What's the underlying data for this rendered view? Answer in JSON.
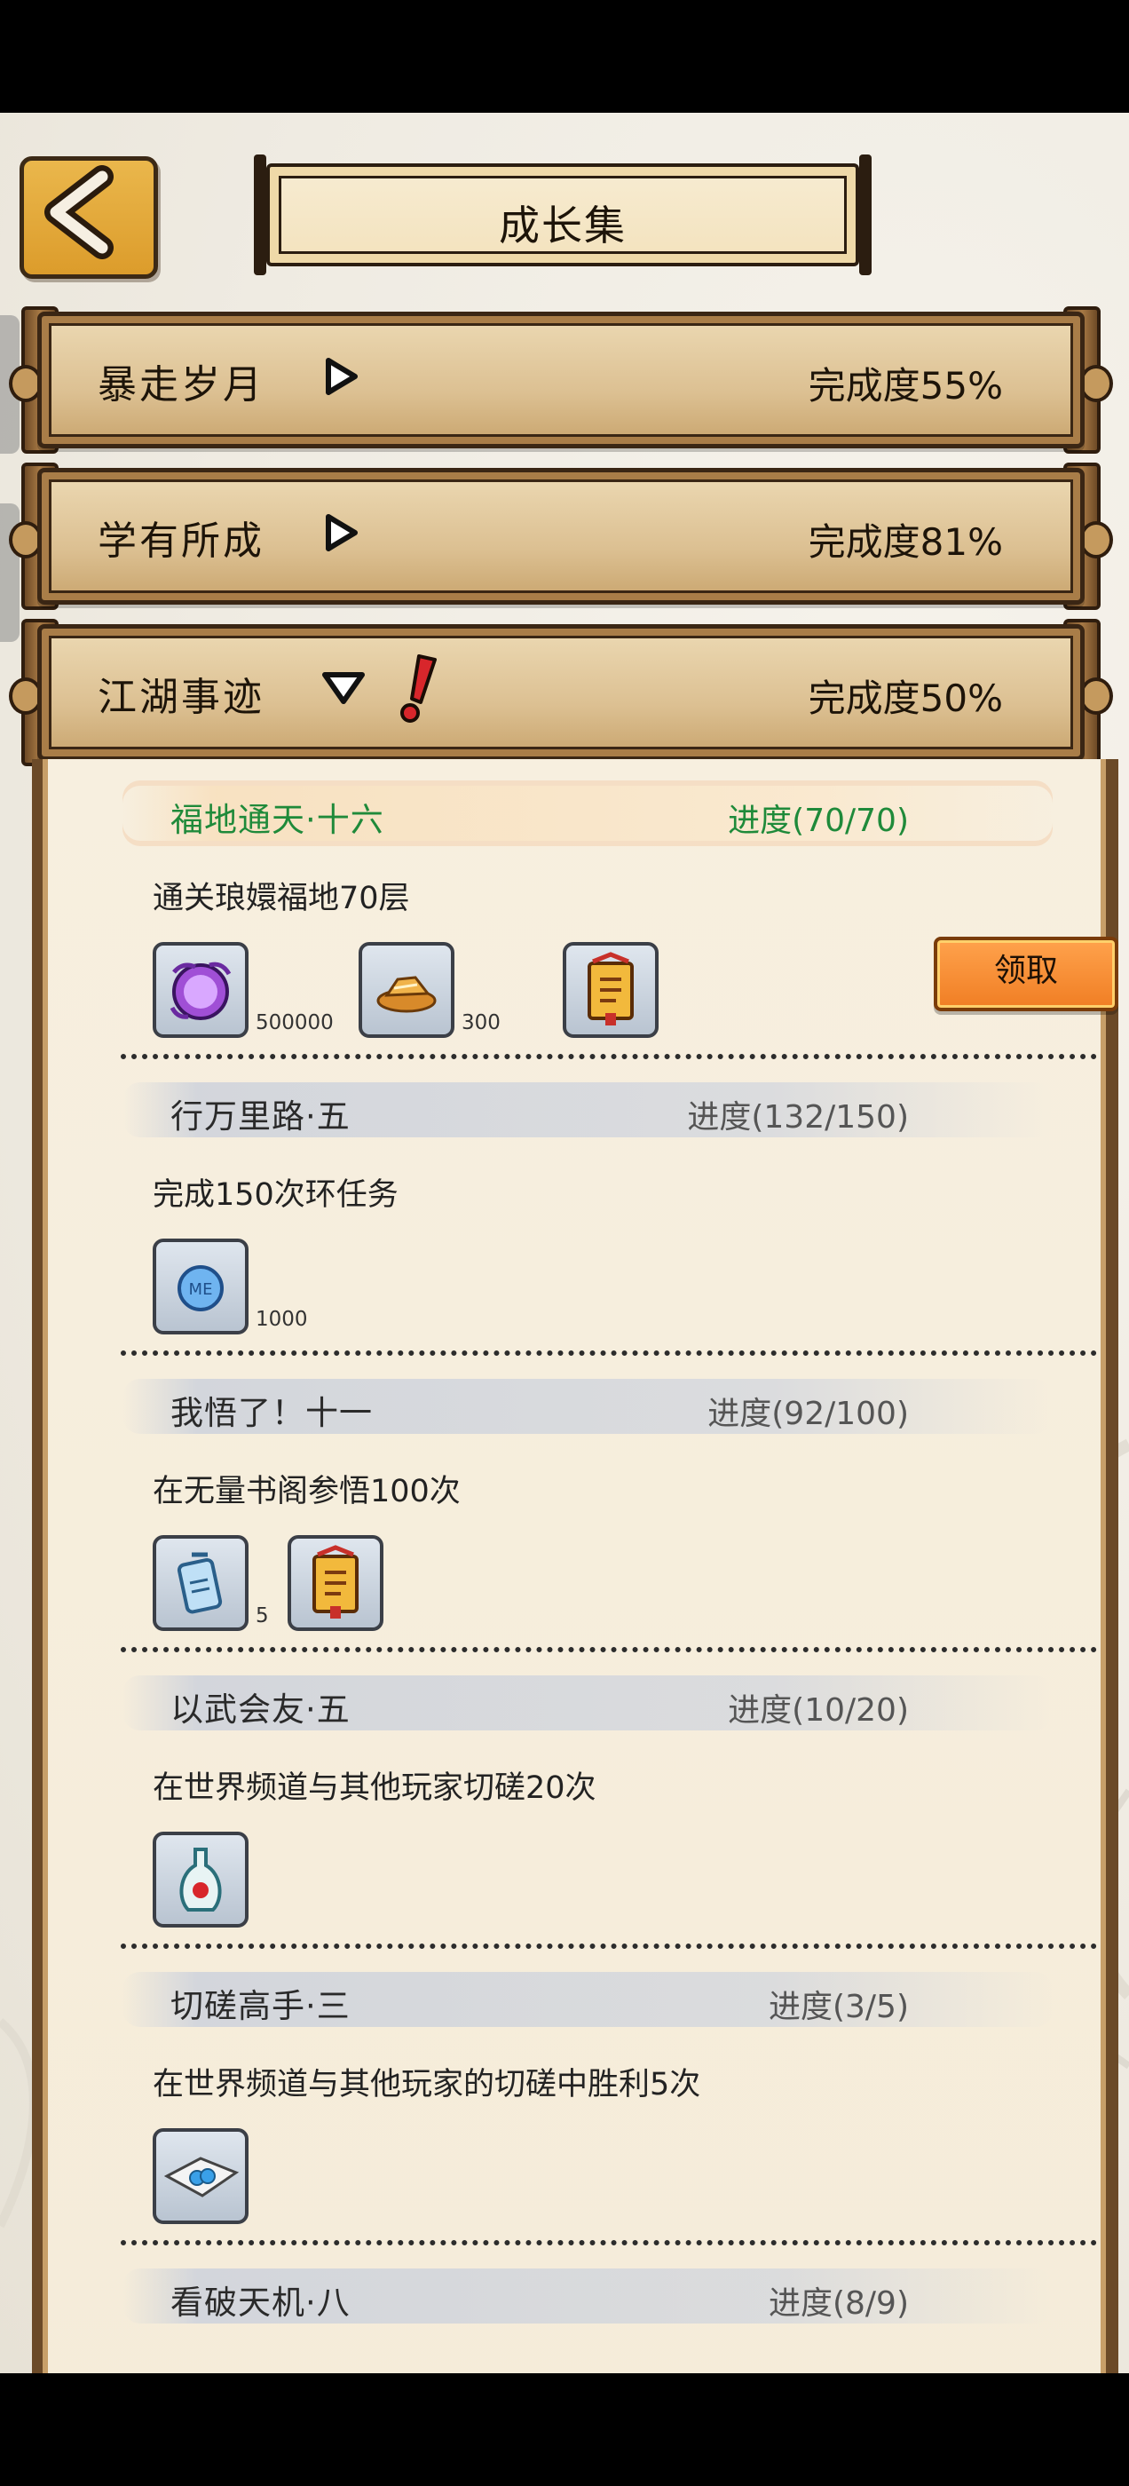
{
  "header": {
    "title": "成长集",
    "back_icon": "chevron-left-icon"
  },
  "categories": [
    {
      "name": "暴走岁月",
      "progress": "完成度55%",
      "state": "collapsed"
    },
    {
      "name": "学有所成",
      "progress": "完成度81%",
      "state": "collapsed"
    },
    {
      "name": "江湖事迹",
      "progress": "完成度50%",
      "state": "expanded",
      "alert": true
    }
  ],
  "tasks": [
    {
      "name": "福地通天·十六",
      "progress": "进度(70/70)",
      "completed": true,
      "desc": "通关琅嬛福地70层",
      "rewards": [
        {
          "icon": "purple-orb-icon",
          "count": "500000"
        },
        {
          "icon": "gold-ingot-icon",
          "count": "300"
        },
        {
          "icon": "scroll-badge-icon",
          "count": ""
        }
      ],
      "claim_label": "领取"
    },
    {
      "name": "行万里路·五",
      "progress": "进度(132/150)",
      "completed": false,
      "desc": "完成150次环任务",
      "rewards": [
        {
          "icon": "blue-coin-icon",
          "count": "1000"
        }
      ]
    },
    {
      "name": "我悟了！十一",
      "progress": "进度(92/100)",
      "completed": false,
      "desc": "在无量书阁参悟100次",
      "rewards": [
        {
          "icon": "blue-token-icon",
          "count": "5"
        },
        {
          "icon": "scroll-badge-icon",
          "count": ""
        }
      ]
    },
    {
      "name": "以武会友·五",
      "progress": "进度(10/20)",
      "completed": false,
      "desc": "在世界频道与其他玩家切磋20次",
      "rewards": [
        {
          "icon": "potion-vase-icon",
          "count": ""
        }
      ]
    },
    {
      "name": "切磋高手·三",
      "progress": "进度(3/5)",
      "completed": false,
      "desc": "在世界频道与其他玩家的切磋中胜利5次",
      "rewards": [
        {
          "icon": "cloth-gem-icon",
          "count": ""
        }
      ]
    },
    {
      "name": "看破天机·八",
      "progress": "进度(8/9)",
      "completed": false
    }
  ],
  "colors": {
    "completed_text": "#1f8a3a",
    "claim_button": "#f07e24",
    "wood_dark": "#3a2614",
    "alert": "#d8262b"
  }
}
